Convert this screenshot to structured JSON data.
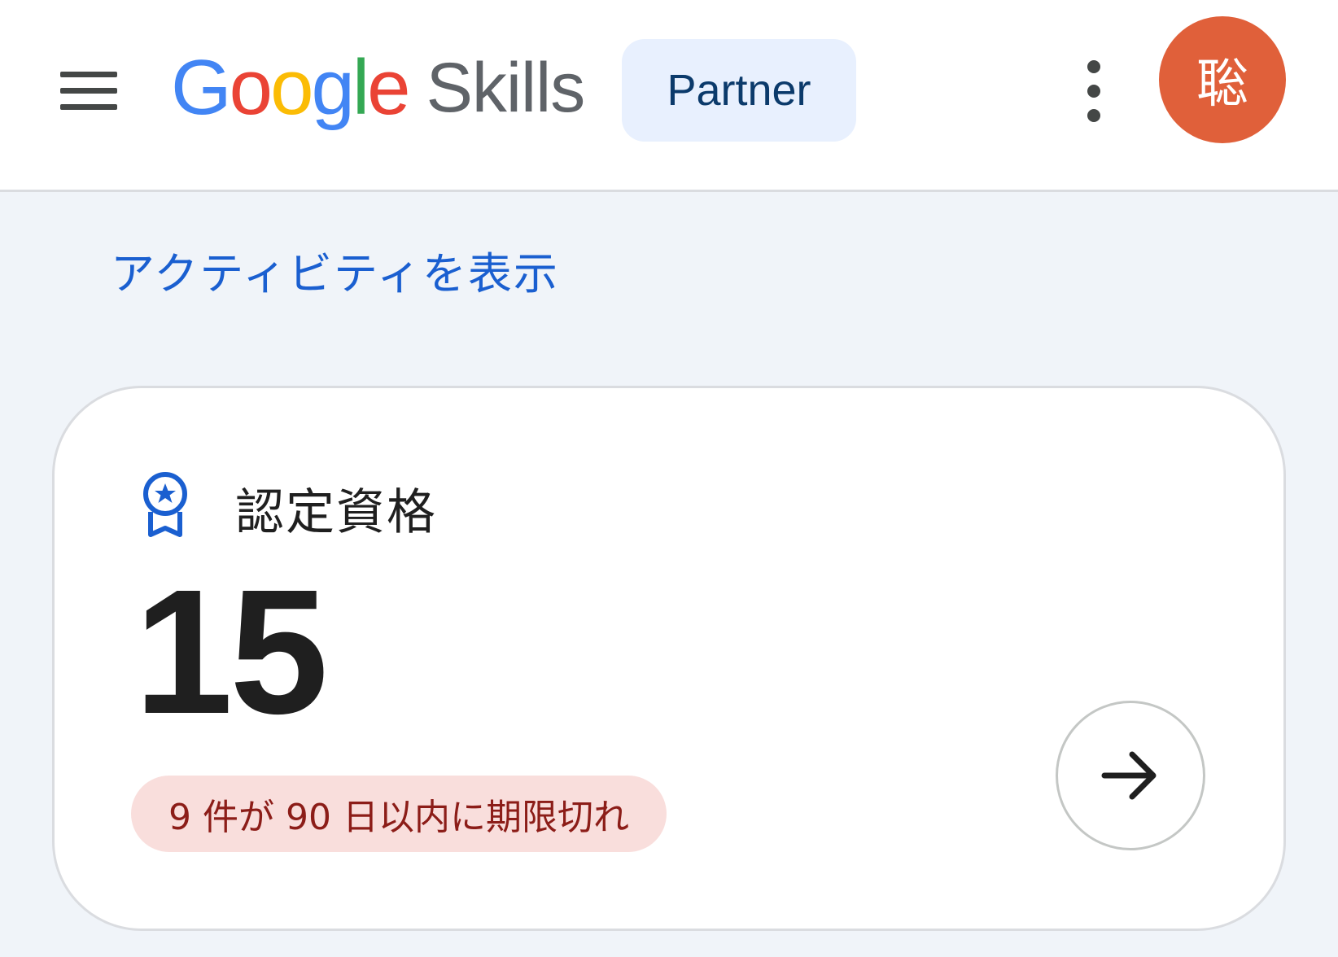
{
  "header": {
    "logo": {
      "google": [
        "G",
        "o",
        "o",
        "g",
        "l",
        "e"
      ],
      "google_colors": [
        "#4285f4",
        "#ea4335",
        "#fbbc05",
        "#4285f4",
        "#34a853",
        "#ea4335"
      ],
      "product": "Skills"
    },
    "partner_label": "Partner",
    "avatar_initial": "聡",
    "avatar_color": "#e0603a"
  },
  "activity_link": "アクティビティを表示",
  "card": {
    "title": "認定資格",
    "icon": "badge-icon",
    "count": "15",
    "expiry_notice": "9 件が 90 日以内に期限切れ",
    "arrow_icon": "arrow-right-icon"
  }
}
